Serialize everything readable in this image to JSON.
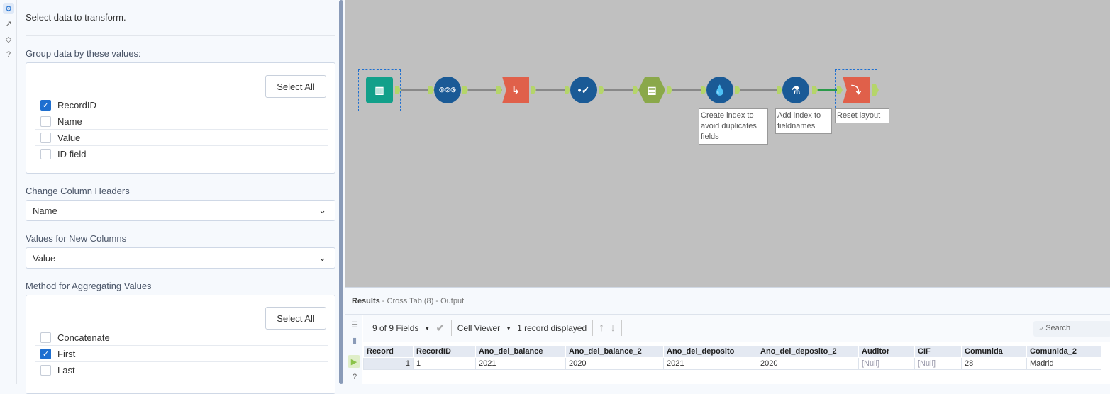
{
  "sidebar_icons": [
    "gear-icon",
    "arrow-circle-icon",
    "tag-icon",
    "help-icon"
  ],
  "panel": {
    "intro": "Select data to transform.",
    "group_label": "Group data by these values:",
    "select_all": "Select All",
    "group_fields": [
      {
        "label": "RecordID",
        "checked": true
      },
      {
        "label": "Name",
        "checked": false
      },
      {
        "label": "Value",
        "checked": false
      },
      {
        "label": "ID field",
        "checked": false
      }
    ],
    "headers_label": "Change Column Headers",
    "headers_value": "Name",
    "values_label": "Values for New Columns",
    "values_value": "Value",
    "method_label": "Method for Aggregating Values",
    "methods": [
      {
        "label": "Concatenate",
        "checked": false
      },
      {
        "label": "First",
        "checked": true
      },
      {
        "label": "Last",
        "checked": false
      }
    ]
  },
  "canvas": {
    "notes": [
      "Create index to avoid duplicates fields",
      "Add index to fieldnames",
      "Reset layout"
    ]
  },
  "results": {
    "title": "Results",
    "subtitle": " - Cross Tab (8) - Output",
    "fields": "9 of 9 Fields",
    "viewer": "Cell Viewer",
    "records": "1 record displayed",
    "search": "Search",
    "columns": [
      "Record",
      "RecordID",
      "Ano_del_balance",
      "Ano_del_balance_2",
      "Ano_del_deposito",
      "Ano_del_deposito_2",
      "Auditor",
      "CIF",
      "Comunida",
      "Comunida_2"
    ],
    "rows": [
      [
        "1",
        "1",
        "2021",
        "2020",
        "2021",
        "2020",
        "[Null]",
        "[Null]",
        "28",
        "Madrid"
      ]
    ]
  }
}
